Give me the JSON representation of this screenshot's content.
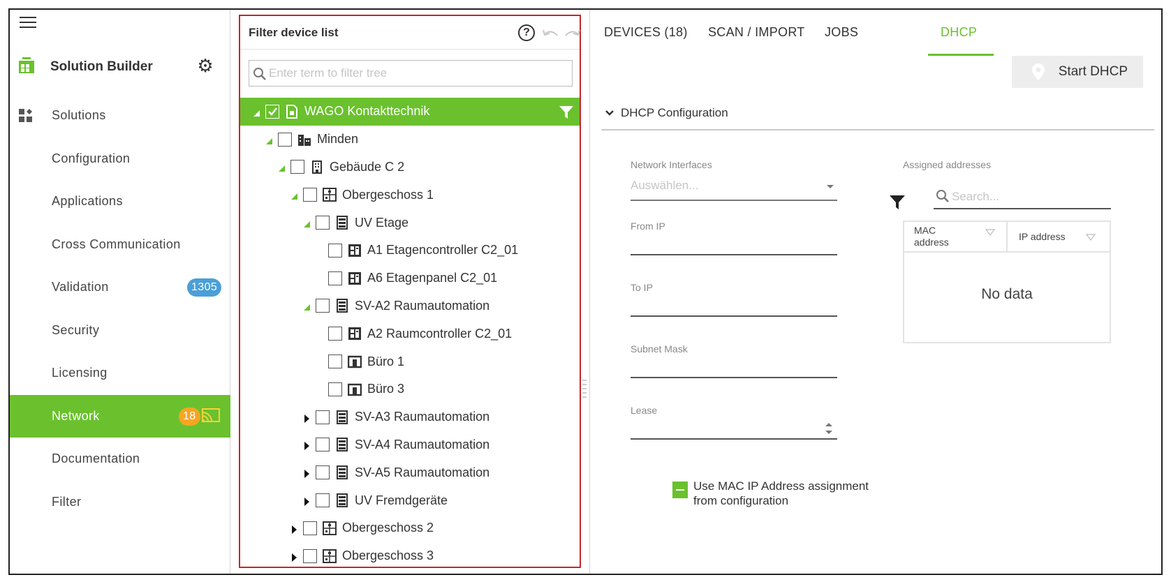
{
  "nav": {
    "brand": "Solution Builder",
    "items": [
      {
        "label": "Solutions"
      },
      {
        "label": "Configuration"
      },
      {
        "label": "Applications"
      },
      {
        "label": "Cross Communication"
      },
      {
        "label": "Validation",
        "badge": "1305"
      },
      {
        "label": "Security"
      },
      {
        "label": "Licensing"
      },
      {
        "label": "Network",
        "badge": "18",
        "active": true
      },
      {
        "label": "Documentation"
      },
      {
        "label": "Filter"
      }
    ]
  },
  "tree_panel": {
    "title": "Filter device list",
    "search_placeholder": "Enter term to filter tree",
    "rows": [
      {
        "label": "WAGO Kontakttechnik",
        "level": 0,
        "twist": "open",
        "checked": true,
        "icon": "site-icon"
      },
      {
        "label": "Minden",
        "level": 1,
        "twist": "open",
        "checked": false,
        "icon": "city-icon"
      },
      {
        "label": "Gebäude C 2",
        "level": 2,
        "twist": "open",
        "checked": false,
        "icon": "building-icon"
      },
      {
        "label": "Obergeschoss 1",
        "level": 3,
        "twist": "open",
        "checked": false,
        "icon": "floor-icon"
      },
      {
        "label": "UV Etage",
        "level": 4,
        "twist": "open",
        "checked": false,
        "icon": "cabinet-icon"
      },
      {
        "label": "A1 Etagencontroller C2_01",
        "level": 5,
        "twist": "none",
        "checked": false,
        "icon": "controller-icon"
      },
      {
        "label": "A6 Etagenpanel C2_01",
        "level": 5,
        "twist": "none",
        "checked": false,
        "icon": "controller-icon"
      },
      {
        "label": "SV-A2 Raumautomation",
        "level": 4,
        "twist": "open",
        "checked": false,
        "icon": "cabinet-icon"
      },
      {
        "label": "A2 Raumcontroller C2_01",
        "level": 5,
        "twist": "none",
        "checked": false,
        "icon": "controller-icon"
      },
      {
        "label": "Büro 1",
        "level": 5,
        "twist": "none",
        "checked": false,
        "icon": "room-icon"
      },
      {
        "label": "Büro 3",
        "level": 5,
        "twist": "none",
        "checked": false,
        "icon": "room-icon"
      },
      {
        "label": "SV-A3 Raumautomation",
        "level": 4,
        "twist": "closed",
        "checked": false,
        "icon": "cabinet-icon"
      },
      {
        "label": "SV-A4 Raumautomation",
        "level": 4,
        "twist": "closed",
        "checked": false,
        "icon": "cabinet-icon"
      },
      {
        "label": "SV-A5 Raumautomation",
        "level": 4,
        "twist": "closed",
        "checked": false,
        "icon": "cabinet-icon"
      },
      {
        "label": "UV Fremdgeräte",
        "level": 4,
        "twist": "closed",
        "checked": false,
        "icon": "cabinet-icon"
      },
      {
        "label": "Obergeschoss 2",
        "level": 3,
        "twist": "closed",
        "checked": false,
        "icon": "floor-icon"
      },
      {
        "label": "Obergeschoss 3",
        "level": 3,
        "twist": "closed",
        "checked": false,
        "icon": "floor-icon"
      }
    ]
  },
  "tabs": [
    {
      "label": "DEVICES (18)"
    },
    {
      "label": "SCAN / IMPORT"
    },
    {
      "label": "JOBS"
    },
    {
      "label": "DHCP",
      "active": true
    }
  ],
  "dhcp": {
    "start_button": "Start DHCP",
    "section_title": "DHCP Configuration",
    "network_interfaces_label": "Network Interfaces",
    "network_interfaces_placeholder": "Auswählen...",
    "from_ip_label": "From IP",
    "to_ip_label": "To IP",
    "subnet_mask_label": "Subnet Mask",
    "lease_label": "Lease",
    "use_mac_label": "Use MAC IP Address assignment from configuration",
    "assigned_label": "Assigned addresses",
    "search_placeholder": "Search...",
    "table_headers": [
      "MAC address",
      "IP address"
    ],
    "empty_text": "No data"
  },
  "colors": {
    "accent": "#6ac12d",
    "highlight_border": "#c8242b",
    "badge_blue": "#4a9fd8",
    "badge_orange": "#f5a623"
  }
}
